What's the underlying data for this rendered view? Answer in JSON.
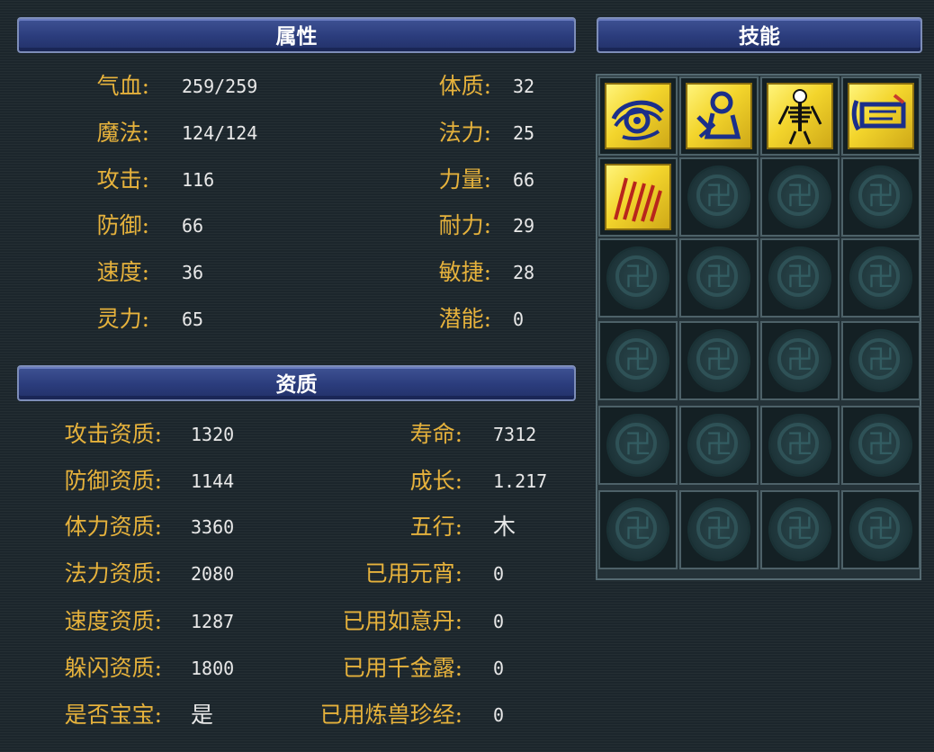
{
  "attributes": {
    "title": "属性",
    "left": [
      {
        "label": "气血:",
        "value": "259/259"
      },
      {
        "label": "魔法:",
        "value": "124/124"
      },
      {
        "label": "攻击:",
        "value": "116"
      },
      {
        "label": "防御:",
        "value": "66"
      },
      {
        "label": "速度:",
        "value": "36"
      },
      {
        "label": "灵力:",
        "value": "65"
      }
    ],
    "right": [
      {
        "label": "体质:",
        "value": "32"
      },
      {
        "label": "法力:",
        "value": "25"
      },
      {
        "label": "力量:",
        "value": "66"
      },
      {
        "label": "耐力:",
        "value": "29"
      },
      {
        "label": "敏捷:",
        "value": "28"
      },
      {
        "label": "潜能:",
        "value": "0"
      }
    ]
  },
  "aptitude": {
    "title": "资质",
    "left": [
      {
        "label": "攻击资质:",
        "value": "1320"
      },
      {
        "label": "防御资质:",
        "value": "1144"
      },
      {
        "label": "体力资质:",
        "value": "3360"
      },
      {
        "label": "法力资质:",
        "value": "2080"
      },
      {
        "label": "速度资质:",
        "value": "1287"
      },
      {
        "label": "躲闪资质:",
        "value": "1800"
      },
      {
        "label": "是否宝宝:",
        "value": "是"
      }
    ],
    "right": [
      {
        "label": "寿命:",
        "value": "7312"
      },
      {
        "label": "成长:",
        "value": "1.217"
      },
      {
        "label": "五行:",
        "value": "木"
      },
      {
        "label": "已用元宵:",
        "value": "0"
      },
      {
        "label": "已用如意丹:",
        "value": "0"
      },
      {
        "label": "已用千金露:",
        "value": "0"
      },
      {
        "label": "已用炼兽珍经:",
        "value": "0"
      }
    ]
  },
  "skills": {
    "title": "技能",
    "columns": 4,
    "rows": 6,
    "learned": [
      "eye-skill-icon",
      "kneeling-figure-skill-icon",
      "skeleton-skill-icon",
      "scroll-skill-icon",
      "claw-scratch-skill-icon"
    ],
    "empty_slot_icon": "empty-slot-emblem-icon"
  },
  "colors": {
    "label": "#e6b23c",
    "value": "#e8e8e8",
    "header": "#2b3c7c",
    "skill_bg": "#f3d52c"
  }
}
